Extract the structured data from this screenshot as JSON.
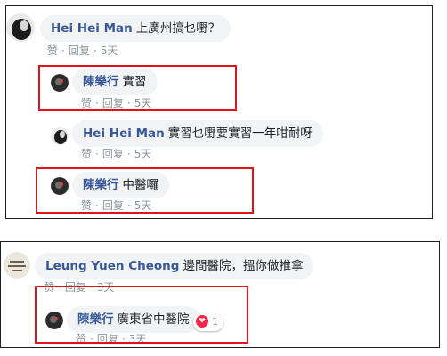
{
  "thread1": {
    "comment": {
      "author": "Hei Hei Man",
      "text": "上廣州搞乜嘢？",
      "like": "赞",
      "reply": "回复",
      "time": "5天"
    },
    "reply1": {
      "author": "陳樂行",
      "text": "實習",
      "like": "赞",
      "reply": "回复",
      "time": "5天"
    },
    "reply2": {
      "author": "Hei Hei Man",
      "text": "實習乜嘢要實習一年咁耐呀",
      "like": "赞",
      "reply": "回复",
      "time": "5天"
    },
    "reply3": {
      "author": "陳樂行",
      "text": "中醫囉",
      "like": "赞",
      "reply": "回复",
      "time": "5天"
    }
  },
  "thread2": {
    "comment": {
      "author": "Leung Yuen Cheong",
      "text": "邊間醫院，搵你做推拿",
      "like": "赞",
      "reply": "回复",
      "time": "3天"
    },
    "reply1": {
      "author": "陳樂行",
      "text": "廣東省中醫院",
      "like": "赞",
      "reply": "回复",
      "time": "3天",
      "reaction_count": "1",
      "reaction_icon": "heart-icon"
    }
  },
  "colors": {
    "highlight": "#e0121b",
    "author": "#385898",
    "bubble": "#f2f3f5",
    "meta": "#8d949e",
    "heart": "#f0284a"
  }
}
